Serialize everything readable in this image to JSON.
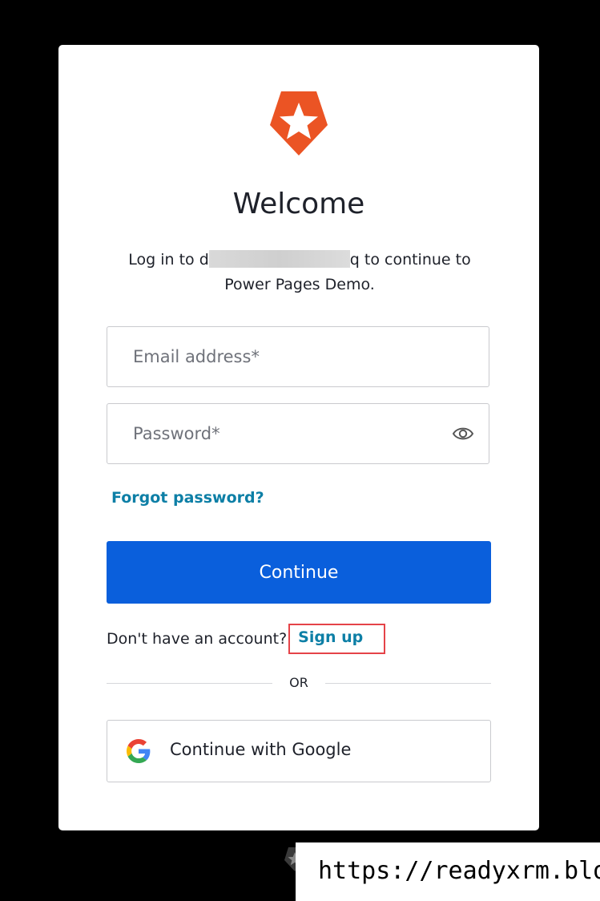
{
  "title": "Welcome",
  "subtitle": {
    "prefix": "Log in to d",
    "suffix": "q to continue to Power Pages Demo."
  },
  "email": {
    "placeholder": "Email address*"
  },
  "password": {
    "placeholder": "Password*"
  },
  "forgot_password": "Forgot password?",
  "continue_label": "Continue",
  "signup": {
    "prompt": "Don't have an account?",
    "link": "Sign up"
  },
  "divider_text": "OR",
  "google": {
    "label": "Continue with Google"
  },
  "watermark_url": "https://readyxrm.blog",
  "colors": {
    "primary": "#0a5fdc",
    "link": "#0d7fa6",
    "logo": "#eb5424",
    "highlight": "#e54348"
  },
  "icons": [
    "auth0-logo-icon",
    "eye-icon",
    "google-icon",
    "auth0-badge-icon"
  ]
}
